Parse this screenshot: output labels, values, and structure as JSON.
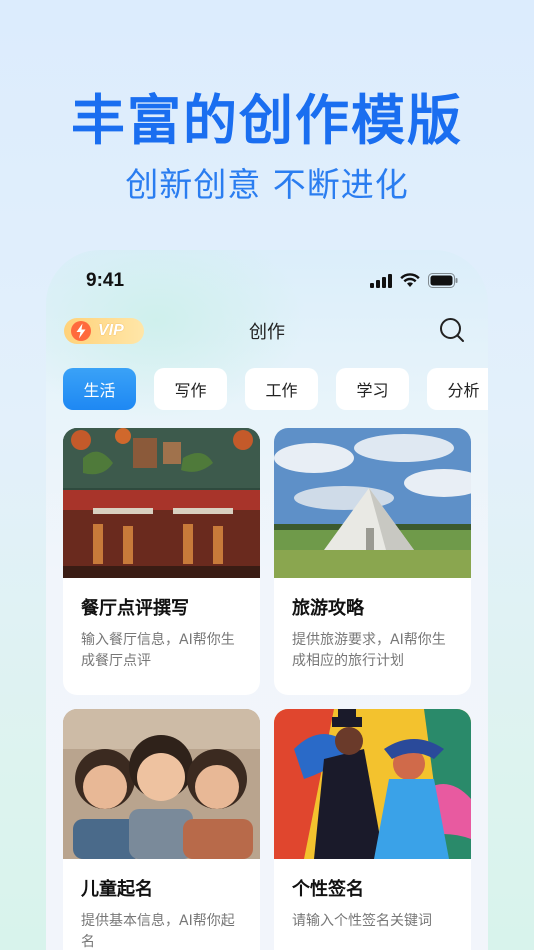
{
  "hero": {
    "title": "丰富的创作模版",
    "subtitle": "创新创意 不断进化"
  },
  "status_bar": {
    "time": "9:41",
    "icons": [
      "signal-icon",
      "wifi-icon",
      "battery-icon"
    ]
  },
  "nav": {
    "vip_label": "VIP",
    "title": "创作",
    "search_icon": "search-icon"
  },
  "tabs": [
    {
      "label": "生活",
      "active": true
    },
    {
      "label": "写作",
      "active": false
    },
    {
      "label": "工作",
      "active": false
    },
    {
      "label": "学习",
      "active": false
    },
    {
      "label": "分析",
      "active": false
    }
  ],
  "cards": [
    {
      "title": "餐厅点评撰写",
      "desc": "输入餐厅信息，AI帮你生成餐厅点评",
      "image": "restaurant-image"
    },
    {
      "title": "旅游攻略",
      "desc": "提供旅游要求，AI帮你生成相应的旅行计划",
      "image": "tent-image"
    },
    {
      "title": "儿童起名",
      "desc": "提供基本信息，AI帮你起名",
      "image": "children-image"
    },
    {
      "title": "个性签名",
      "desc": "请输入个性签名关键词",
      "image": "art-image"
    }
  ],
  "colors": {
    "accent": "#1a6ef0",
    "tab_active": "#1e88f3",
    "vip": "#ffd27a"
  }
}
